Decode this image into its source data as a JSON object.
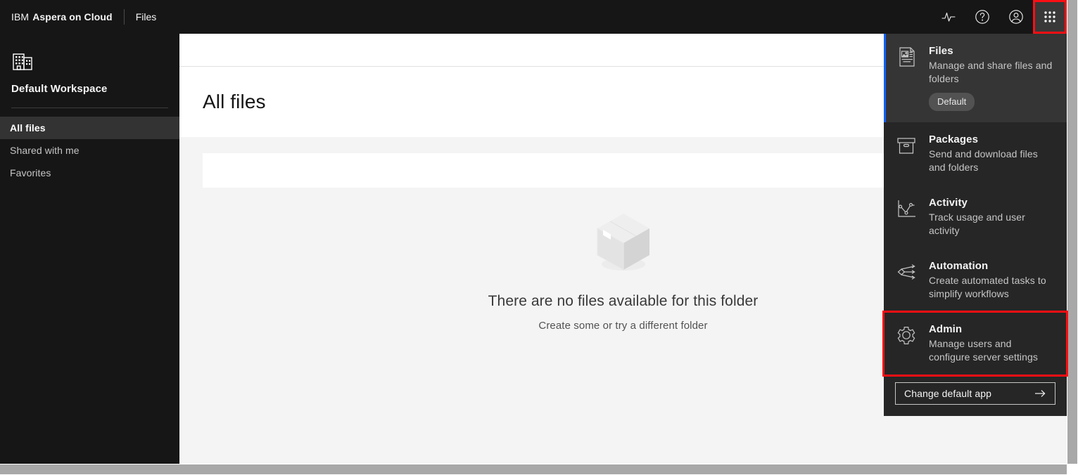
{
  "header": {
    "brand_prefix": "IBM",
    "brand_name": "Aspera on Cloud",
    "nav_link": "Files",
    "icons": {
      "activity": "activity-pulse-icon",
      "help": "help-question-icon",
      "account": "user-account-icon",
      "switcher": "app-switcher-grid-icon"
    }
  },
  "sidebar": {
    "workspace_icon": "buildings-icon",
    "workspace_name": "Default Workspace",
    "items": [
      {
        "label": "All files",
        "selected": true
      },
      {
        "label": "Shared with me",
        "selected": false
      },
      {
        "label": "Favorites",
        "selected": false
      }
    ]
  },
  "main": {
    "page_title": "All files",
    "empty_state": {
      "illustration": "empty-box-icon",
      "title": "There are no files available for this folder",
      "subtitle": "Create some or try a different folder"
    }
  },
  "switcher": {
    "apps": [
      {
        "icon": "files-document-image-icon",
        "title": "Files",
        "description": "Manage and share files and folders",
        "badge": "Default",
        "active": true,
        "highlighted": false
      },
      {
        "icon": "packages-box-icon",
        "title": "Packages",
        "description": "Send and download files and folders",
        "badge": null,
        "active": false,
        "highlighted": false
      },
      {
        "icon": "activity-chart-icon",
        "title": "Activity",
        "description": "Track usage and user activity",
        "badge": null,
        "active": false,
        "highlighted": false
      },
      {
        "icon": "automation-flow-icon",
        "title": "Automation",
        "description": "Create automated tasks to simplify workflows",
        "badge": null,
        "active": false,
        "highlighted": false
      },
      {
        "icon": "admin-gear-icon",
        "title": "Admin",
        "description": "Manage users and configure server settings",
        "badge": null,
        "active": false,
        "highlighted": true
      }
    ],
    "change_default_label": "Change default app",
    "change_default_icon": "arrow-right-icon"
  },
  "colors": {
    "header_bg": "#161616",
    "panel_bg": "#262626",
    "active_item_bg": "#353535",
    "accent_blue": "#0f62fe",
    "highlight_red": "#fa0f14",
    "canvas_bg": "#f4f4f4",
    "scrollbar": "#a8a8a8"
  }
}
